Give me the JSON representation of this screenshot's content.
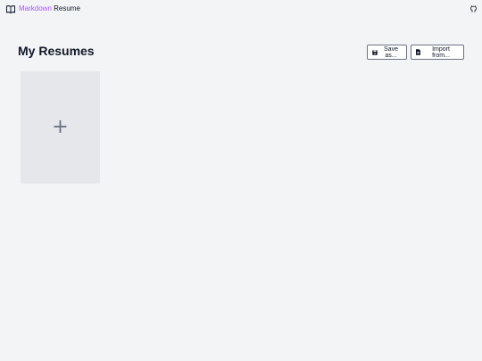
{
  "header": {
    "brand_accent": "Markdown",
    "brand_rest": " Resume",
    "brand_icon": "book-open-icon",
    "github_icon": "github-icon"
  },
  "main": {
    "title": "My Resumes",
    "toolbar": {
      "save_label": "Save as...",
      "save_icon": "save-icon",
      "import_label": "Import from...",
      "import_icon": "file-icon"
    },
    "new_resume_card": {
      "icon": "plus-icon",
      "glyph": "+"
    }
  },
  "colors": {
    "background": "#f3f4f6",
    "accent": "#a855f7",
    "card": "#e5e7eb",
    "text": "#111827"
  }
}
